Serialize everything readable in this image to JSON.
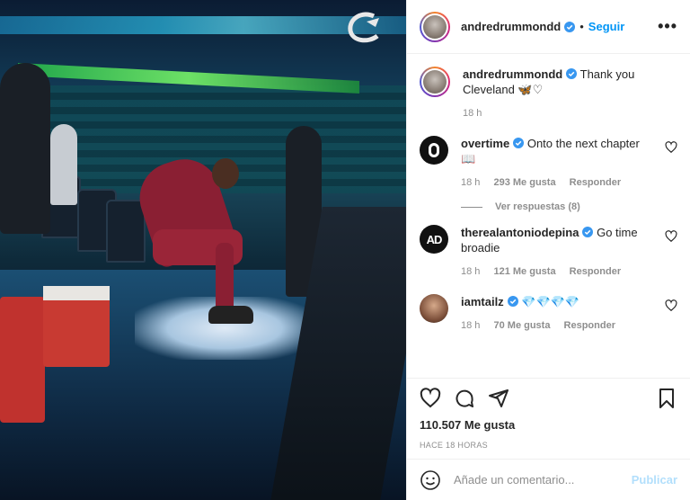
{
  "post": {
    "author": "andredrummondd",
    "follow_label": "Seguir",
    "dot": "•",
    "more_label": "•••"
  },
  "caption": {
    "username": "andredrummondd",
    "text": "Thank you Cleveland 🦋♡",
    "time": "18 h"
  },
  "comments": [
    {
      "username": "overtime",
      "text": "Onto the next chapter 📖",
      "time": "18 h",
      "likes": "293 Me gusta",
      "reply_label": "Responder",
      "view_replies": "Ver respuestas (8)"
    },
    {
      "username": "therealantoniodepina",
      "text": "Go time broadie",
      "time": "18 h",
      "likes": "121 Me gusta",
      "reply_label": "Responder",
      "avatar_text": "AD"
    },
    {
      "username": "iamtailz",
      "text": "💎💎💎💎",
      "time": "18 h",
      "likes": "70 Me gusta",
      "reply_label": "Responder"
    }
  ],
  "footer": {
    "likes": "110.507 Me gusta",
    "timestamp": "HACE 18 HORAS",
    "comment_placeholder": "Añade un comentario...",
    "publish_label": "Publicar"
  },
  "colors": {
    "accent": "#0095f6",
    "verified": "#3897f0",
    "publish_disabled": "#b2dffc",
    "muted": "#8e8e8e"
  },
  "icons": [
    "cavaliers-logo-icon",
    "verified-icon",
    "more-icon",
    "heart-icon",
    "comment-icon",
    "share-icon",
    "bookmark-icon",
    "emoji-icon"
  ]
}
